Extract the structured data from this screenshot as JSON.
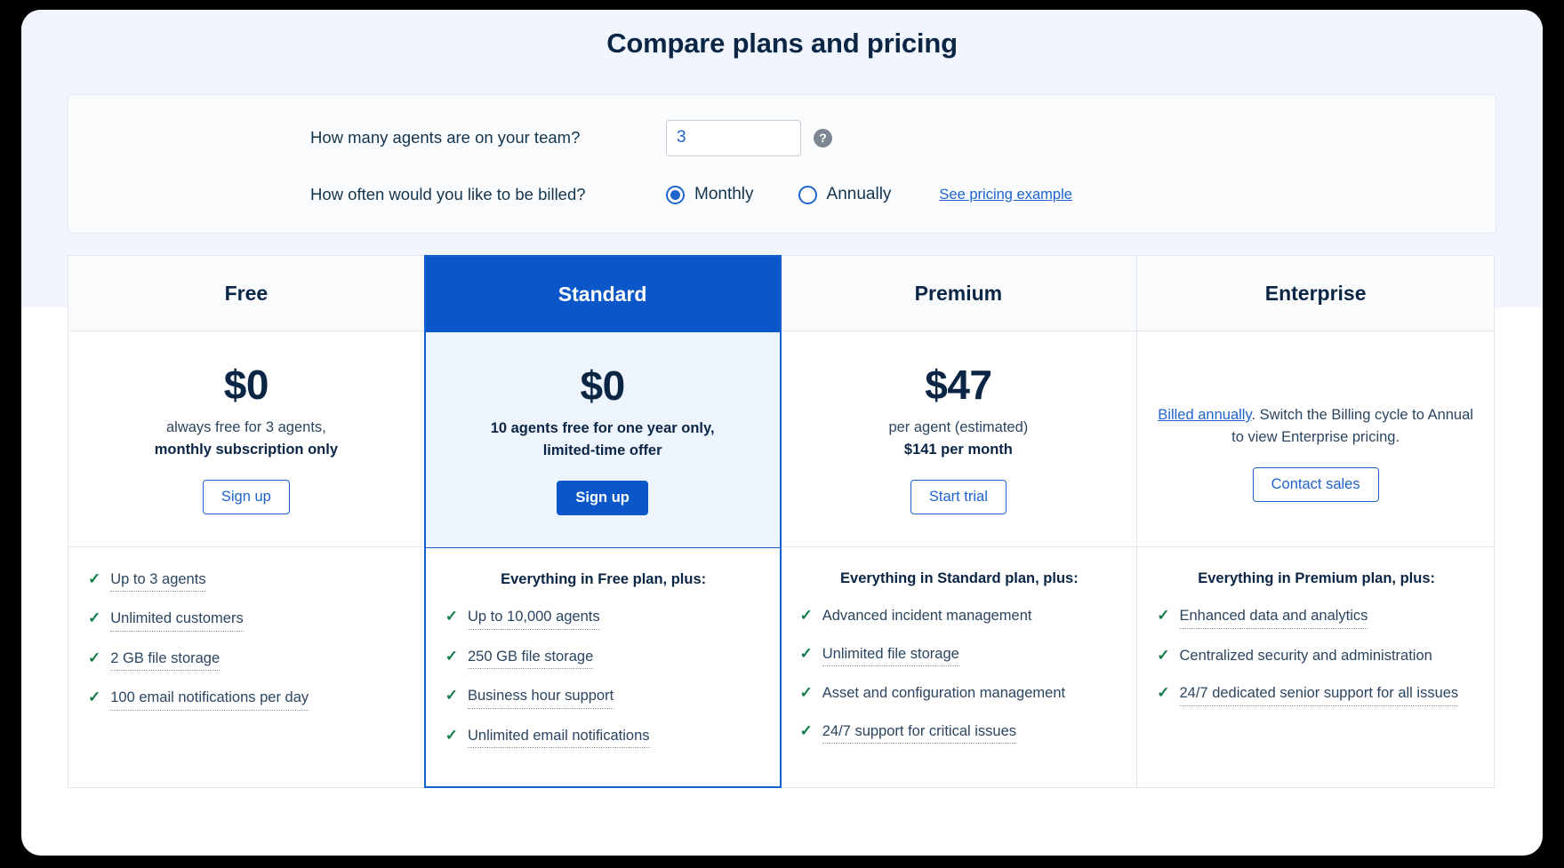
{
  "page_title": "Compare plans and pricing",
  "config": {
    "agents_label": "How many agents are on your team?",
    "agents_value": "3",
    "agents_placeholder": "",
    "help_icon": "?",
    "billing_label": "How often would you like to be billed?",
    "billing_options": [
      {
        "label": "Monthly",
        "selected": true
      },
      {
        "label": "Annually",
        "selected": false
      }
    ],
    "pricing_example_link": "See pricing example"
  },
  "plans": [
    {
      "name": "Free",
      "featured": false,
      "price": "$0",
      "note_line1": "always free for 3 agents,",
      "note_line2": "monthly subscription only",
      "note_line2_bold": true,
      "cta": "Sign up",
      "cta_primary": false,
      "features_title": "",
      "features": [
        {
          "text": "Up to 3 agents",
          "dotted": true
        },
        {
          "text": "Unlimited customers",
          "dotted": true
        },
        {
          "text": "2 GB file storage",
          "dotted": true
        },
        {
          "text": "100 email notifications per day",
          "dotted": true
        }
      ]
    },
    {
      "name": "Standard",
      "featured": true,
      "price": "$0",
      "note_line1": "10 agents free for one year only,",
      "note_line2": "limited-time offer",
      "note_line1_bold": true,
      "note_line2_bold": true,
      "cta": "Sign up",
      "cta_primary": true,
      "features_title": "Everything in Free plan, plus:",
      "features": [
        {
          "text": "Up to 10,000 agents",
          "dotted": true
        },
        {
          "text": "250 GB file storage",
          "dotted": true
        },
        {
          "text": "Business hour support",
          "dotted": true
        },
        {
          "text": "Unlimited email notifications",
          "dotted": true
        }
      ]
    },
    {
      "name": "Premium",
      "featured": false,
      "price": "$47",
      "note_line1": "per agent (estimated)",
      "note_line2": "$141 per month",
      "note_line2_bold": true,
      "cta": "Start trial",
      "cta_primary": false,
      "features_title": "Everything in Standard plan, plus:",
      "features": [
        {
          "text": "Advanced incident management",
          "dotted": false
        },
        {
          "text": "Unlimited file storage",
          "dotted": true
        },
        {
          "text": "Asset and configuration management",
          "dotted": false
        },
        {
          "text": "24/7 support for critical issues",
          "dotted": true
        }
      ]
    },
    {
      "name": "Enterprise",
      "featured": false,
      "price": "",
      "note_link": "Billed annually",
      "note_rest": ". Switch the Billing cycle to Annual to view Enterprise pricing.",
      "cta": "Contact sales",
      "cta_primary": false,
      "features_title": "Everything in Premium plan, plus:",
      "features": [
        {
          "text": "Enhanced data and analytics",
          "dotted": true
        },
        {
          "text": "Centralized security and administration",
          "dotted": false
        },
        {
          "text": "24/7 dedicated senior support for all issues",
          "dotted": true
        }
      ]
    }
  ],
  "colors": {
    "accent_blue": "#0b57c9",
    "link_blue": "#1f63cc",
    "check_green": "#127c47",
    "title_navy": "#0b2545",
    "tint_bg": "#f1f6fe",
    "featured_bg": "#eef4fd"
  }
}
